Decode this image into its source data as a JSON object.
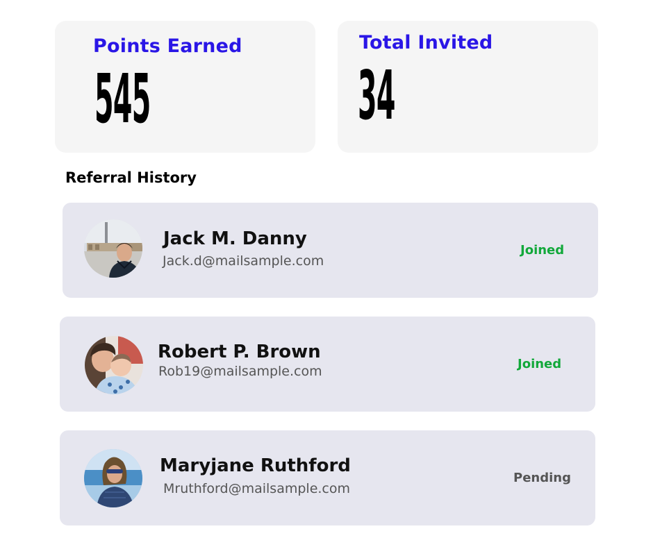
{
  "stats": {
    "points": {
      "label": "Points Earned",
      "value": "545"
    },
    "invited": {
      "label": "Total Invited",
      "value": "34"
    }
  },
  "referral_history": {
    "title": "Referral History",
    "items": [
      {
        "name": "Jack M. Danny",
        "email": "Jack.d@mailsample.com",
        "status": "Joined",
        "status_color": "#12a83a",
        "avatar": "avatar-photo-man-selfie"
      },
      {
        "name": "Robert P. Brown",
        "email": "Rob19@mailsample.com",
        "status": "Joined",
        "status_color": "#12a83a",
        "avatar": "avatar-photo-parent-child"
      },
      {
        "name": "Maryjane Ruthford",
        "email": "Mruthford@mailsample.com",
        "status": "Pending",
        "status_color": "#555555",
        "avatar": "avatar-photo-woman-beach"
      }
    ]
  },
  "colors": {
    "accent": "#2a16e6",
    "card_bg": "#f5f5f5",
    "row_bg": "#e6e6ef",
    "joined": "#12a83a",
    "pending": "#555555"
  }
}
